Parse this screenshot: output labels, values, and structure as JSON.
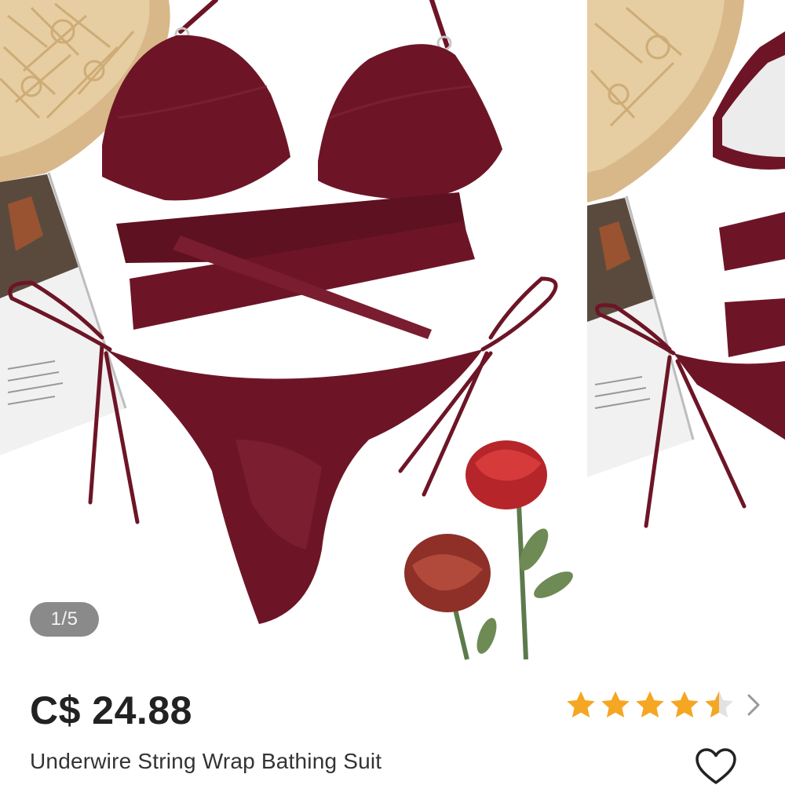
{
  "gallery": {
    "counter": "1/5",
    "current": 1,
    "total": 5
  },
  "product": {
    "price": "C$ 24.88",
    "title": "Underwire String Wrap Bathing Suit",
    "rating": 4.5,
    "rating_max": 5
  },
  "colors": {
    "accent_star": "#f5a623",
    "fabric": "#6d1526",
    "text": "#222222",
    "counter_bg": "#8a8a8a"
  },
  "icons": {
    "rating_more": "chevron-right-icon",
    "wishlist": "heart-outline-icon"
  }
}
